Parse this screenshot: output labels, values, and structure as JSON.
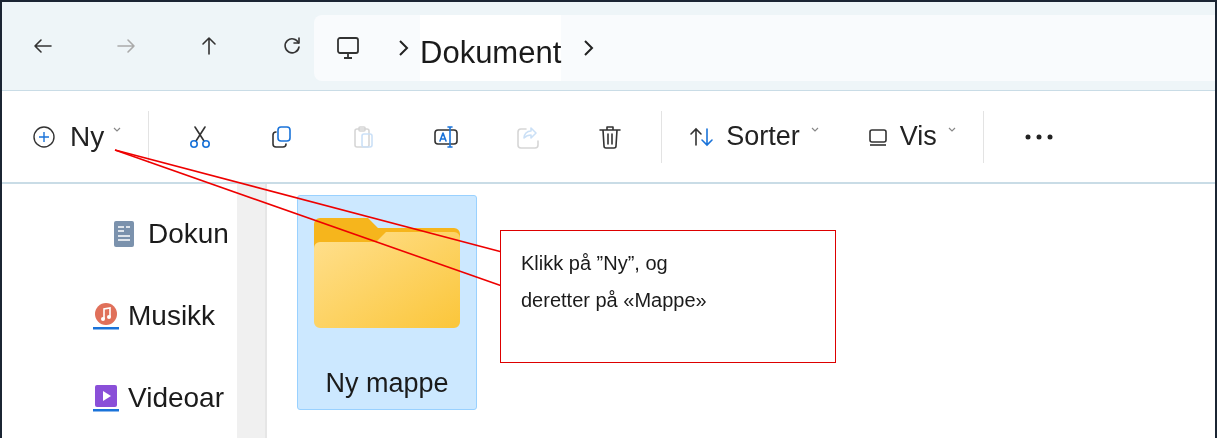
{
  "nav": [
    {
      "kind": "back",
      "disabled": false
    },
    {
      "kind": "forward",
      "disabled": true
    },
    {
      "kind": "up",
      "disabled": false
    },
    {
      "kind": "refresh",
      "disabled": false
    }
  ],
  "breadcrumb": {
    "segments": [
      "Dokument"
    ]
  },
  "toolbar": {
    "new": {
      "label": "Ny"
    },
    "actions": [
      {
        "kind": "cut",
        "disabled": false
      },
      {
        "kind": "copy",
        "disabled": false
      },
      {
        "kind": "paste",
        "disabled": true
      },
      {
        "kind": "rename",
        "disabled": false
      },
      {
        "kind": "share",
        "disabled": true
      },
      {
        "kind": "delete",
        "disabled": false
      }
    ],
    "sort": {
      "label": "Sorter"
    },
    "view": {
      "label": "Vis"
    }
  },
  "sidebar": {
    "items": [
      {
        "kind": "documents",
        "label": "Dokun"
      },
      {
        "kind": "music",
        "label": "Musikk"
      },
      {
        "kind": "videos",
        "label": "Videoar"
      }
    ]
  },
  "files": [
    {
      "name": "Ny mappe",
      "selected": true
    }
  ],
  "callout": {
    "text": "Klikk på ”Ny”, og deretter på «Mappe»"
  }
}
